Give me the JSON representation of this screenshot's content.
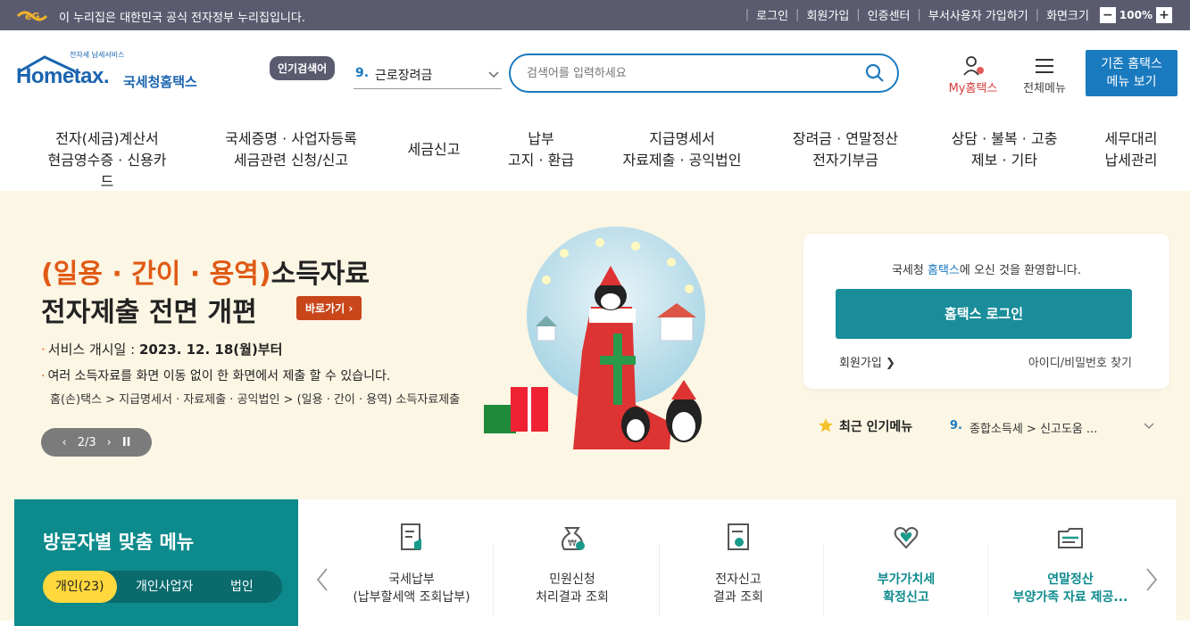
{
  "topbar": {
    "gov_notice": "이 누리집은 대한민국 공식 전자정부 누리집입니다.",
    "links": [
      "로그인",
      "회원가입",
      "인증센터",
      "부서사용자 가입하기",
      "화면크기"
    ],
    "zoom_minus": "−",
    "zoom_level": "100%",
    "zoom_plus": "+"
  },
  "header": {
    "logo_tagline": "전자세 납세서비스",
    "logo_text": "Hometax.",
    "logo_kor": "국세청홈택스",
    "popular_badge": "인기검색어",
    "popular_num": "9.",
    "popular_term": "근로장려금",
    "search_placeholder": "검색어를 입력하세요",
    "my_hometax": "My홈택스",
    "all_menu": "전체메뉴",
    "old_menu_line1": "기존 홈택스",
    "old_menu_line2": "메뉴 보기"
  },
  "gnb": [
    {
      "line1": "전자(세금)계산서",
      "line2": "현금영수증 · 신용카드"
    },
    {
      "line1": "국세증명 · 사업자등록",
      "line2": "세금관련 신청/신고"
    },
    {
      "line1": "세금신고",
      "line2": ""
    },
    {
      "line1": "납부",
      "line2": "고지 · 환급"
    },
    {
      "line1": "지급명세서",
      "line2": "자료제출 · 공익법인"
    },
    {
      "line1": "장려금 · 연말정산",
      "line2": "전자기부금"
    },
    {
      "line1": "상담 · 불복 · 고충",
      "line2": "제보 · 기타"
    },
    {
      "line1": "세무대리",
      "line2": "납세관리"
    }
  ],
  "hero": {
    "title_accent": "(일용 · 간이 · 용역)",
    "title_rest": "소득자료",
    "title_line2": "전자제출 전면 개편",
    "goto_label": "바로가기 ›",
    "bullet1_label": "서비스 개시일 : ",
    "bullet1_value": "2023. 12. 18(월)부터",
    "bullet2": "여러 소득자료를 화면 이동 없이 한 화면에서 제출 할 수 있습니다.",
    "path": "홈(손)택스 > 지급명세서 · 자료제출 · 공익법인 > (일용 · 간이 · 용역) 소득자료제출",
    "pager_prev": "‹",
    "pager_text": "2/3",
    "pager_next": "›",
    "pager_pause": "II"
  },
  "login_card": {
    "welcome_pre": "국세청 ",
    "welcome_hl": "홈택스",
    "welcome_post": "에 오신 것을 환영합니다.",
    "login_button": "홈택스 로그인",
    "join": "회원가입 ❯",
    "find": "아이디/비밀번호 찾기"
  },
  "recent": {
    "label": "최근 인기메뉴",
    "num": "9.",
    "text": "종합소득세 > 신고도움 ..."
  },
  "visitor": {
    "title": "방문자별 맞춤 메뉴",
    "tabs": [
      "개인(23)",
      "개인사업자",
      "법인"
    ]
  },
  "quick": [
    {
      "l1": "국세납부",
      "l2": "(납부할세액 조회납부)",
      "icon": "tax-payment-icon",
      "highlight": false
    },
    {
      "l1": "민원신청",
      "l2": "처리결과 조회",
      "icon": "money-bag-icon",
      "highlight": false
    },
    {
      "l1": "전자신고",
      "l2": "결과 조회",
      "icon": "document-check-icon",
      "highlight": false
    },
    {
      "l1": "부가가치세",
      "l2": "확정신고",
      "icon": "heart-hands-icon",
      "highlight": true
    },
    {
      "l1": "연말정산",
      "l2": "부양가족 자료 제공...",
      "icon": "folder-doc-icon",
      "highlight": true
    }
  ],
  "colors": {
    "topbar": "#5b5b70",
    "brand_blue": "#1a7abf",
    "teal": "#0d8a8c",
    "hero_bg": "#fcf6e4",
    "accent_orange": "#e05a15"
  }
}
